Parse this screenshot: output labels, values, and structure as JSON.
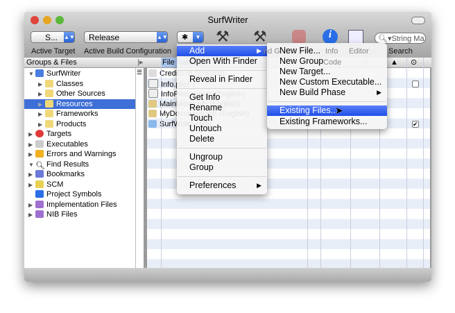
{
  "window": {
    "title": "SurfWriter"
  },
  "toolbar": {
    "target_value": "S...",
    "config_value": "Release",
    "search_placeholder": "String Ma",
    "labels": {
      "active_target": "Active Target",
      "active_build_config": "Active Build Configuration",
      "build_and_go_partial": "nd G",
      "info": "Info",
      "editor": "Editor",
      "search": "Search"
    }
  },
  "sidebar": {
    "header": "Groups & Files",
    "items": [
      {
        "label": "SurfWriter",
        "icon": "project-icon",
        "level": 0,
        "expanded": true
      },
      {
        "label": "Classes",
        "icon": "folder-icon",
        "level": 1
      },
      {
        "label": "Other Sources",
        "icon": "folder-icon",
        "level": 1
      },
      {
        "label": "Resources",
        "icon": "folder-icon",
        "level": 1,
        "selected": true
      },
      {
        "label": "Frameworks",
        "icon": "folder-icon",
        "level": 1
      },
      {
        "label": "Products",
        "icon": "folder-icon",
        "level": 1
      },
      {
        "label": "Targets",
        "icon": "target-icon",
        "level": 0
      },
      {
        "label": "Executables",
        "icon": "executable-icon",
        "level": 0
      },
      {
        "label": "Errors and Warnings",
        "icon": "warning-icon",
        "level": 0
      },
      {
        "label": "Find Results",
        "icon": "magnifier-icon",
        "level": 0,
        "expanded": true
      },
      {
        "label": "Bookmarks",
        "icon": "bookmark-icon",
        "level": 0
      },
      {
        "label": "SCM",
        "icon": "scm-icon",
        "level": 0
      },
      {
        "label": "Project Symbols",
        "icon": "symbols-icon",
        "level": 0,
        "no_disclosure": true
      },
      {
        "label": "Implementation Files",
        "icon": "smart-group-icon",
        "level": 0
      },
      {
        "label": "NIB Files",
        "icon": "smart-group-icon",
        "level": 0
      }
    ]
  },
  "file_list": {
    "columns": {
      "file_name": "File Name",
      "code": "Code"
    },
    "rows": [
      {
        "name": "Credits.rtf (English)",
        "checked": null
      },
      {
        "name": "Info.plist",
        "checked": false
      },
      {
        "name": "InfoPlist.strings (English)",
        "checked": null
      },
      {
        "name": "MainMenu.nib (English)",
        "checked": null
      },
      {
        "name": "MyDocument.nib (English)",
        "checked": null
      },
      {
        "name": "SurfWriter Help",
        "checked": true
      }
    ]
  },
  "context_menu": {
    "items": [
      "Add",
      "Open With Finder",
      "Reveal in Finder",
      "Get Info",
      "Rename",
      "Touch",
      "Untouch",
      "Delete",
      "Ungroup",
      "Group",
      "Preferences"
    ]
  },
  "add_submenu": {
    "items": [
      "New File...",
      "New Group",
      "New Target...",
      "New Custom Executable...",
      "New Build Phase",
      "Existing Files...",
      "Existing Frameworks..."
    ],
    "highlighted": "Existing Files..."
  },
  "colors": {
    "selection": "#3d6fd6",
    "menu_highlight": "#2a5af0"
  }
}
